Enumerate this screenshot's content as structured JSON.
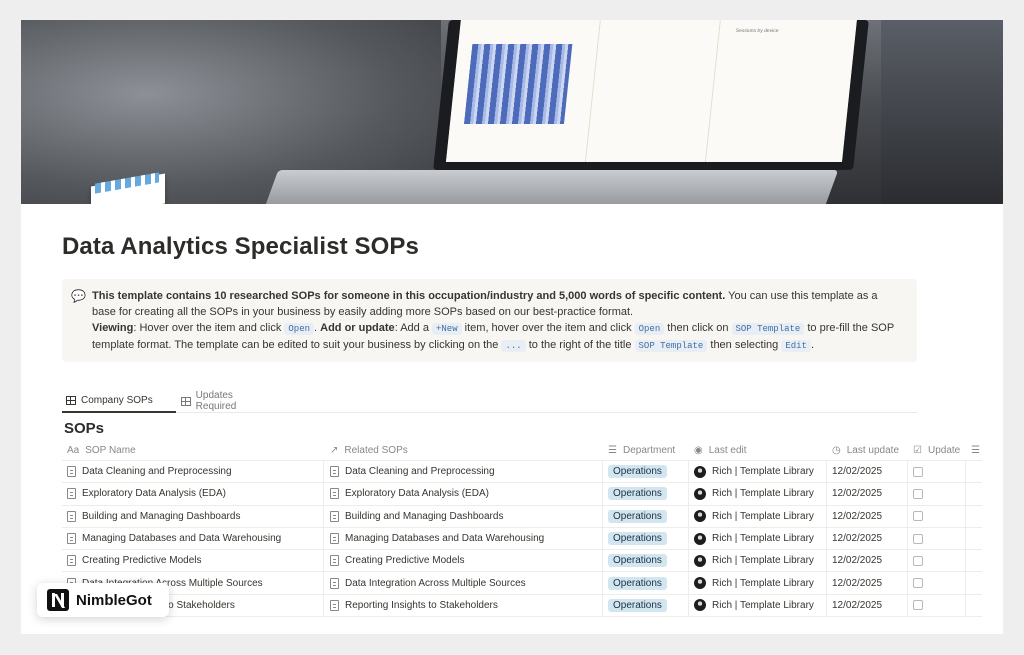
{
  "page": {
    "title": "Data Analytics Specialist SOPs"
  },
  "cover": {
    "screen_labels": [
      "Sessions by device"
    ]
  },
  "callout": {
    "icon": "speech-bubble-icon",
    "bold_intro": "This template contains 10 researched SOPs for someone in this occupation/industry and 5,000 words of specific content.",
    "intro_rest": " You can use this template as a base for creating all the SOPs in your business by easily adding more SOPs based on our best-practice format.",
    "viewing_label": "Viewing",
    "viewing_text": ": Hover over the item and click ",
    "open_code": "Open",
    "add_label": "Add or update",
    "add_text_1": ": Add a ",
    "new_code": "+New",
    "add_text_2": " item, hover over the item and click ",
    "open_code_2": "Open",
    "add_text_3": " then click on ",
    "sop_template_code": "SOP Template",
    "add_text_4": " to pre-fill the SOP template format. The template can be edited to suit your business by clicking on the ",
    "dots_code": "...",
    "add_text_5": " to the right of the title ",
    "sop_template_code_2": "SOP Template",
    "add_text_6": " then selecting ",
    "edit_code": "Edit",
    "add_text_7": "."
  },
  "tabs": [
    {
      "label": "Company SOPs",
      "active": true
    },
    {
      "label": "Updates Required",
      "active": false
    }
  ],
  "database": {
    "title": "SOPs",
    "columns": {
      "name": {
        "icon": "Aa",
        "label": "SOP Name"
      },
      "related": {
        "icon": "↗",
        "label": "Related SOPs"
      },
      "department": {
        "icon": "☰",
        "label": "Department"
      },
      "last_edit": {
        "icon": "◉",
        "label": "Last edit"
      },
      "last_update": {
        "icon": "◷",
        "label": "Last update"
      },
      "update": {
        "icon": "☑",
        "label": "Update"
      }
    },
    "rows": [
      {
        "name": "Data Cleaning and Preprocessing",
        "related": "Data Cleaning and Preprocessing",
        "department": "Operations",
        "editor": "Rich | Template Library",
        "date": "12/02/2025",
        "update": false
      },
      {
        "name": "Exploratory Data Analysis (EDA)",
        "related": "Exploratory Data Analysis (EDA)",
        "department": "Operations",
        "editor": "Rich | Template Library",
        "date": "12/02/2025",
        "update": false
      },
      {
        "name": "Building and Managing Dashboards",
        "related": "Building and Managing Dashboards",
        "department": "Operations",
        "editor": "Rich | Template Library",
        "date": "12/02/2025",
        "update": false
      },
      {
        "name": "Managing Databases and Data Warehousing",
        "related": "Managing Databases and Data Warehousing",
        "department": "Operations",
        "editor": "Rich | Template Library",
        "date": "12/02/2025",
        "update": false
      },
      {
        "name": "Creating Predictive Models",
        "related": "Creating Predictive Models",
        "department": "Operations",
        "editor": "Rich | Template Library",
        "date": "12/02/2025",
        "update": false
      },
      {
        "name": "Data Integration Across Multiple Sources",
        "related": "Data Integration Across Multiple Sources",
        "department": "Operations",
        "editor": "Rich | Template Library",
        "date": "12/02/2025",
        "update": false
      },
      {
        "name": "Reporting Insights to Stakeholders",
        "related": "Reporting Insights to Stakeholders",
        "department": "Operations",
        "editor": "Rich | Template Library",
        "date": "12/02/2025",
        "update": false
      }
    ]
  },
  "badge": {
    "text": "NimbleGot"
  }
}
